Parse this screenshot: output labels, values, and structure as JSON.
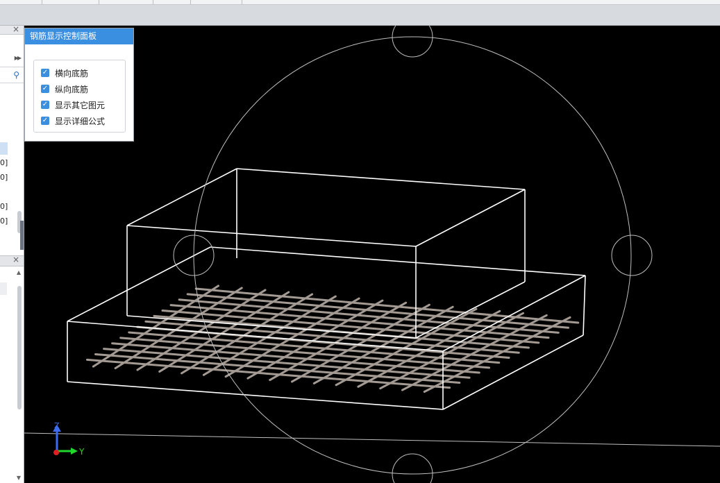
{
  "panel": {
    "title": "钢筋显示控制面板",
    "options": [
      {
        "label": "横向底筋",
        "checked": true
      },
      {
        "label": "纵向底筋",
        "checked": true
      },
      {
        "label": "显示其它图元",
        "checked": true
      },
      {
        "label": "显示详细公式",
        "checked": true
      }
    ]
  },
  "left_panel": {
    "items": [
      "0]",
      "0]",
      "0]",
      "0]"
    ]
  },
  "axes": {
    "z_label": "Z",
    "y_label": "Y"
  },
  "colors": {
    "viewport_bg": "#000000",
    "accent": "#3b8fe0",
    "rebar": "#a39a93",
    "wireframe": "#ffffff",
    "z_axis": "#3d6cf0",
    "y_axis": "#23d62d",
    "origin": "#e02020"
  }
}
